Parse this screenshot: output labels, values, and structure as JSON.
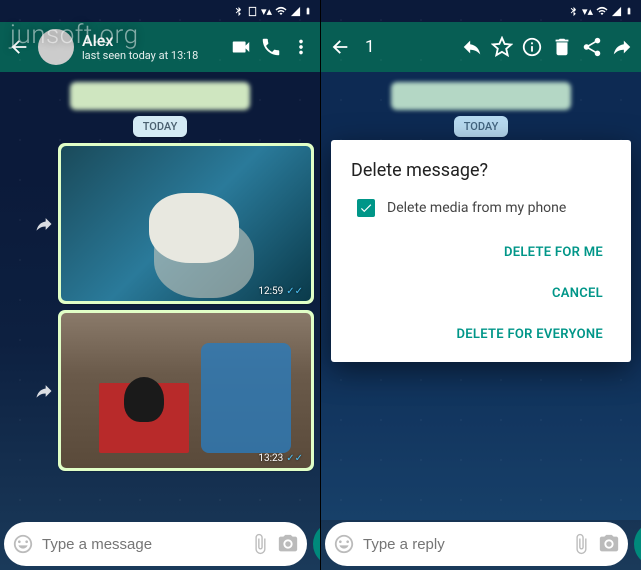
{
  "watermark": "junsoft.org",
  "left": {
    "contact_name": "Alex",
    "last_seen": "last seen today at 13:18",
    "date_separator": "TODAY",
    "messages": [
      {
        "time": "12:59"
      },
      {
        "time": "13:23"
      }
    ],
    "input_placeholder": "Type a message"
  },
  "right": {
    "selection_count": "1",
    "date_separator": "TODAY",
    "input_placeholder": "Type a reply",
    "dialog": {
      "title": "Delete message?",
      "checkbox_label": "Delete media from my phone",
      "checkbox_checked": true,
      "actions": {
        "delete_me": "DELETE FOR ME",
        "cancel": "CANCEL",
        "delete_everyone": "DELETE FOR EVERYONE"
      }
    }
  }
}
